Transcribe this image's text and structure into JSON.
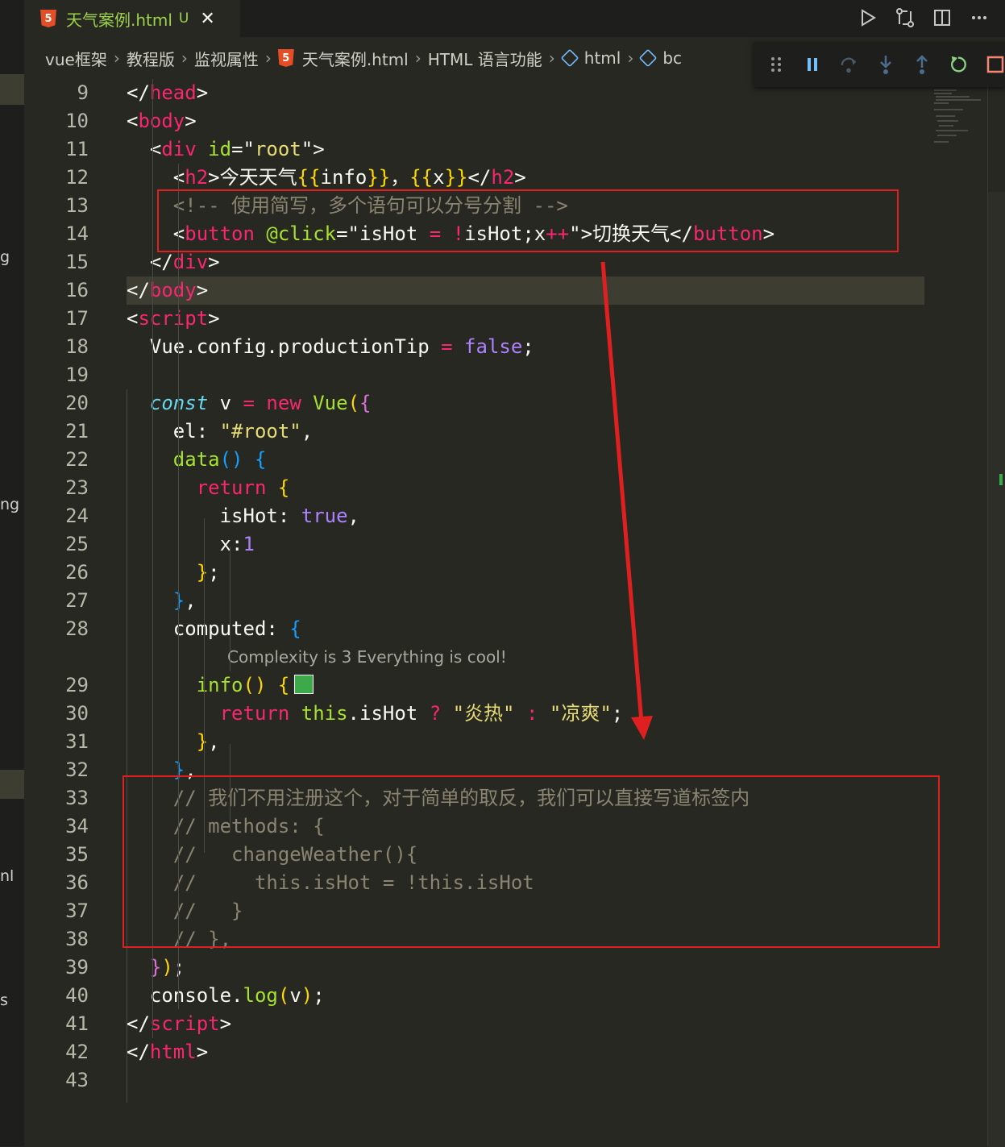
{
  "tab": {
    "filename": "天气案例.html",
    "modified": "U",
    "html5_badge": "5",
    "close_glyph": "✕"
  },
  "actions": [
    "run-icon",
    "compare-changes-icon",
    "split-editor-icon",
    "more-actions-icon"
  ],
  "breadcrumbs": [
    "vue框架",
    "教程版",
    "监视属性",
    "天气案例.html",
    "HTML 语言功能",
    "html",
    "bc"
  ],
  "debug_toolbar": [
    "drag-handle-icon",
    "pause-icon",
    "step-over-icon",
    "step-into-icon",
    "step-out-icon",
    "restart-icon",
    "stop-icon"
  ],
  "left_fragments": [
    "g",
    "ng",
    "nl",
    "s"
  ],
  "code_lens": "Complexity is 3 Everything is cool!",
  "lines": [
    {
      "n": "9",
      "seg": [
        [
          "pun",
          "</"
        ],
        [
          "tag",
          "head"
        ],
        [
          "pun",
          ">"
        ]
      ]
    },
    {
      "n": "10",
      "seg": [
        [
          "pun",
          "<"
        ],
        [
          "tag",
          "body"
        ],
        [
          "pun",
          ">"
        ]
      ]
    },
    {
      "n": "11",
      "seg": [
        [
          "pun",
          "  <"
        ],
        [
          "tag",
          "div"
        ],
        [
          "pun",
          " "
        ],
        [
          "attr",
          "id"
        ],
        [
          "pun",
          "=\""
        ],
        [
          "str",
          "root"
        ],
        [
          "pun",
          "\">"
        ]
      ]
    },
    {
      "n": "12",
      "seg": [
        [
          "pun",
          "    <"
        ],
        [
          "tag",
          "h2"
        ],
        [
          "pun",
          ">今天天气"
        ],
        [
          "br1",
          "{{"
        ],
        [
          "plain",
          "info"
        ],
        [
          "br1",
          "}}"
        ],
        [
          "pun",
          "，"
        ],
        [
          "br1",
          "{{"
        ],
        [
          "plain",
          "x"
        ],
        [
          "br1",
          "}}"
        ],
        [
          "pun",
          "</"
        ],
        [
          "tag",
          "h2"
        ],
        [
          "pun",
          ">"
        ]
      ]
    },
    {
      "n": "13",
      "seg": [
        [
          "cmt",
          "    <!-- 使用简写，多个语句可以分号分割 -->"
        ]
      ]
    },
    {
      "n": "14",
      "seg": [
        [
          "pun",
          "    <"
        ],
        [
          "tag",
          "button"
        ],
        [
          "pun",
          " "
        ],
        [
          "attr",
          "@click"
        ],
        [
          "pun",
          "=\""
        ],
        [
          "plain",
          "isHot "
        ],
        [
          "kw",
          "="
        ],
        [
          "plain",
          " "
        ],
        [
          "kw",
          "!"
        ],
        [
          "plain",
          "isHot;x"
        ],
        [
          "kw",
          "++"
        ],
        [
          "pun",
          "\">切换天气</"
        ],
        [
          "tag",
          "button"
        ],
        [
          "pun",
          ">"
        ]
      ]
    },
    {
      "n": "15",
      "seg": [
        [
          "pun",
          "  </"
        ],
        [
          "tag",
          "div"
        ],
        [
          "pun",
          ">"
        ]
      ]
    },
    {
      "n": "16",
      "seg": [
        [
          "pun",
          "</"
        ],
        [
          "tag",
          "body"
        ],
        [
          "pun",
          ">"
        ]
      ],
      "hl": true
    },
    {
      "n": "17",
      "seg": [
        [
          "pun",
          "<"
        ],
        [
          "tag",
          "script"
        ],
        [
          "pun",
          ">"
        ]
      ]
    },
    {
      "n": "18",
      "seg": [
        [
          "plain",
          "  Vue.config.productionTip "
        ],
        [
          "kw",
          "="
        ],
        [
          "plain",
          " "
        ],
        [
          "con",
          "false"
        ],
        [
          "plain",
          ";"
        ]
      ]
    },
    {
      "n": "19",
      "seg": []
    },
    {
      "n": "20",
      "seg": [
        [
          "plain",
          "  "
        ],
        [
          "sto",
          "const"
        ],
        [
          "plain",
          " v "
        ],
        [
          "kw",
          "="
        ],
        [
          "plain",
          " "
        ],
        [
          "kw",
          "new"
        ],
        [
          "plain",
          " "
        ],
        [
          "fn",
          "Vue"
        ],
        [
          "br1",
          "("
        ],
        [
          "br2",
          "{"
        ]
      ]
    },
    {
      "n": "21",
      "seg": [
        [
          "plain",
          "    el: "
        ],
        [
          "str",
          "\"#root\""
        ],
        [
          "plain",
          ","
        ]
      ]
    },
    {
      "n": "22",
      "seg": [
        [
          "plain",
          "    "
        ],
        [
          "fn",
          "data"
        ],
        [
          "br3",
          "()"
        ],
        [
          "plain",
          " "
        ],
        [
          "br3",
          "{"
        ]
      ]
    },
    {
      "n": "23",
      "seg": [
        [
          "plain",
          "      "
        ],
        [
          "kw",
          "return"
        ],
        [
          "plain",
          " "
        ],
        [
          "br1",
          "{"
        ]
      ]
    },
    {
      "n": "24",
      "seg": [
        [
          "plain",
          "        isHot: "
        ],
        [
          "con",
          "true"
        ],
        [
          "plain",
          ","
        ]
      ]
    },
    {
      "n": "25",
      "seg": [
        [
          "plain",
          "        x:"
        ],
        [
          "con",
          "1"
        ]
      ]
    },
    {
      "n": "26",
      "seg": [
        [
          "plain",
          "      "
        ],
        [
          "br1",
          "}"
        ],
        [
          "plain",
          ";"
        ]
      ]
    },
    {
      "n": "27",
      "seg": [
        [
          "plain",
          "    "
        ],
        [
          "br3",
          "}"
        ],
        [
          "plain",
          ","
        ]
      ]
    },
    {
      "n": "28",
      "seg": [
        [
          "plain",
          "    computed: "
        ],
        [
          "br3",
          "{"
        ]
      ]
    },
    {
      "n": "29",
      "seg": [
        [
          "plain",
          "      "
        ],
        [
          "fn",
          "info"
        ],
        [
          "br1",
          "()"
        ],
        [
          "plain",
          " "
        ],
        [
          "br1",
          "{"
        ]
      ],
      "swatch": "#3caa4a"
    },
    {
      "n": "30",
      "seg": [
        [
          "plain",
          "        "
        ],
        [
          "kw",
          "return"
        ],
        [
          "plain",
          " "
        ],
        [
          "fn",
          "this"
        ],
        [
          "plain",
          ".isHot "
        ],
        [
          "kw",
          "?"
        ],
        [
          "plain",
          " "
        ],
        [
          "str",
          "\"炎热\""
        ],
        [
          "plain",
          " "
        ],
        [
          "kw",
          ":"
        ],
        [
          "plain",
          " "
        ],
        [
          "str",
          "\"凉爽\""
        ],
        [
          "plain",
          ";"
        ]
      ]
    },
    {
      "n": "31",
      "seg": [
        [
          "plain",
          "      "
        ],
        [
          "br1",
          "}"
        ],
        [
          "plain",
          ","
        ]
      ]
    },
    {
      "n": "32",
      "seg": [
        [
          "plain",
          "    "
        ],
        [
          "br3",
          "}"
        ],
        [
          "plain",
          ","
        ]
      ]
    },
    {
      "n": "33",
      "seg": [
        [
          "cmt",
          "    // 我们不用注册这个，对于简单的取反，我们可以直接写道标签内"
        ]
      ]
    },
    {
      "n": "34",
      "seg": [
        [
          "cmt",
          "    // methods: {"
        ]
      ]
    },
    {
      "n": "35",
      "seg": [
        [
          "cmt",
          "    //   changeWeather(){"
        ]
      ]
    },
    {
      "n": "36",
      "seg": [
        [
          "cmt",
          "    //     this.isHot = !this.isHot"
        ]
      ]
    },
    {
      "n": "37",
      "seg": [
        [
          "cmt",
          "    //   }"
        ]
      ]
    },
    {
      "n": "38",
      "seg": [
        [
          "cmt",
          "    // },"
        ]
      ]
    },
    {
      "n": "39",
      "seg": [
        [
          "plain",
          "  "
        ],
        [
          "br2",
          "}"
        ],
        [
          "br1",
          ")"
        ],
        [
          "plain",
          ";"
        ]
      ]
    },
    {
      "n": "40",
      "seg": [
        [
          "plain",
          "  console."
        ],
        [
          "fn",
          "log"
        ],
        [
          "br1",
          "("
        ],
        [
          "plain",
          "v"
        ],
        [
          "br1",
          ")"
        ],
        [
          "plain",
          ";"
        ]
      ]
    },
    {
      "n": "41",
      "seg": [
        [
          "pun",
          "</"
        ],
        [
          "tag",
          "script"
        ],
        [
          "pun",
          ">"
        ]
      ]
    },
    {
      "n": "42",
      "seg": [
        [
          "pun",
          "</"
        ],
        [
          "tag",
          "html"
        ],
        [
          "pun",
          ">"
        ]
      ]
    },
    {
      "n": "43",
      "seg": []
    }
  ],
  "colors": {
    "background": "#272822",
    "annotation_red": "#e02020",
    "highlight": "#3e3d32"
  }
}
